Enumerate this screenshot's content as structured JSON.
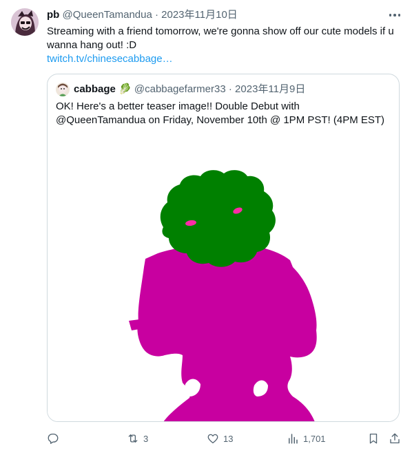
{
  "tweet": {
    "author_name": "pb",
    "author_handle": "@QueenTamandua",
    "separator": "·",
    "date": "2023年11月10日",
    "text": "Streaming with a friend tomorrow, we're gonna show off our cute models if u wanna hang out! :D",
    "link": "twitch.tv/chinesecabbage…"
  },
  "quote": {
    "author_name": "cabbage",
    "author_emoji": "🥬",
    "author_handle": "@cabbagefarmer33",
    "separator": "·",
    "date": "2023年11月9日",
    "text": "OK! Here's a better teaser image!! Double Debut with @QueenTamandua on Friday, November 10th @ 1PM PST! (4PM EST)"
  },
  "actions": {
    "replies": "",
    "retweets": "3",
    "likes": "13",
    "views": "1,701"
  },
  "colors": {
    "silhouette": "#c800a0",
    "cabbage": "#008000",
    "link": "#1d9bf0",
    "muted": "#536471"
  }
}
